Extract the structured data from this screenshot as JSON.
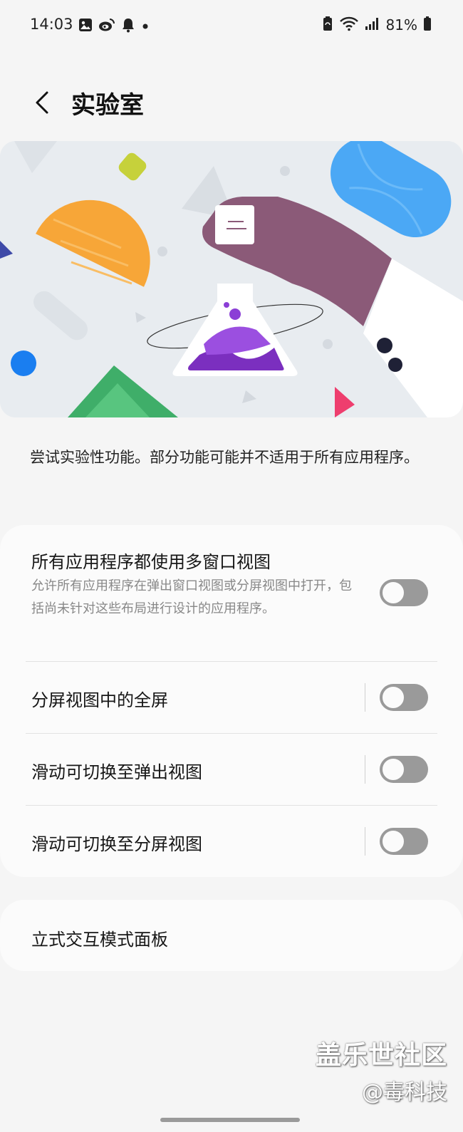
{
  "status_bar": {
    "time": "14:03",
    "battery_percent": "81%",
    "left_icons": [
      "gallery-icon",
      "weibo-icon",
      "bell-icon",
      "dot-icon"
    ],
    "right_icons": [
      "battery-saver-icon",
      "wifi-icon",
      "signal-icon",
      "battery-icon"
    ]
  },
  "header": {
    "back_icon": "chevron-left-icon",
    "title": "实验室"
  },
  "description": "尝试实验性功能。部分功能可能并不适用于所有应用程序。",
  "settings": [
    {
      "title": "所有应用程序都使用多窗口视图",
      "subtitle": "允许所有应用程序在弹出窗口视图或分屏视图中打开，包括尚未针对这些布局进行设计的应用程序。",
      "enabled": false
    },
    {
      "title": "分屏视图中的全屏",
      "enabled": false
    },
    {
      "title": "滑动可切换至弹出视图",
      "enabled": false
    },
    {
      "title": "滑动可切换至分屏视图",
      "enabled": false
    }
  ],
  "panel_item": {
    "title": "立式交互模式面板"
  },
  "watermark": {
    "line1": "盖乐世社区",
    "line2": "@毒科技"
  },
  "colors": {
    "background": "#f5f5f5",
    "card": "#fbfbfb",
    "toggle_off": "#9a9a9a",
    "illustration_purple": "#7b2fbf",
    "illustration_hand": "#8b5a78",
    "illustration_orange": "#f7a638",
    "illustration_blue": "#4ba8f5",
    "illustration_green": "#3fae69"
  }
}
